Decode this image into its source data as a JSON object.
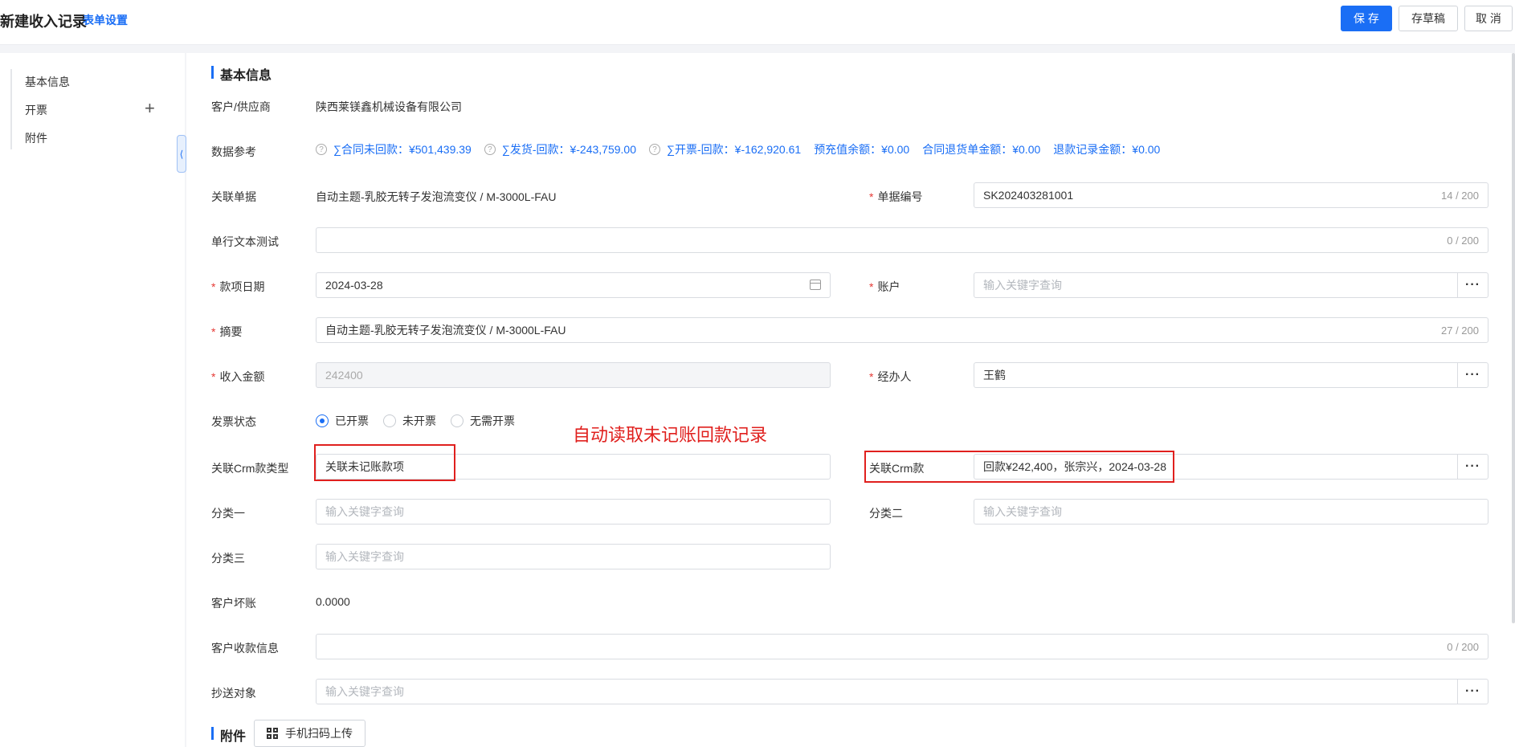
{
  "header": {
    "title": "新建收入记录",
    "form_settings": "表单设置",
    "save": "保 存",
    "draft": "存草稿",
    "cancel": "取 消"
  },
  "sidebar": {
    "items": [
      {
        "label": "基本信息"
      },
      {
        "label": "开票"
      },
      {
        "label": "附件"
      }
    ],
    "add_icon": "plus-icon",
    "collapse_glyph": "⟨"
  },
  "section_basic": "基本信息",
  "section_attachment": "附件",
  "fields": {
    "customer": {
      "label": "客户/供应商",
      "value": "陕西莱镁鑫机械设备有限公司"
    },
    "data_ref": {
      "label": "数据参考",
      "items": [
        "∑合同未回款：¥501,439.39",
        "∑发货-回款：¥-243,759.00",
        "∑开票-回款：¥-162,920.61",
        "预充值余额：¥0.00",
        "合同退货单金额：¥0.00",
        "退款记录金额：¥0.00"
      ]
    },
    "related_doc": {
      "label": "关联单据",
      "value": "自动主题-乳胶无转子发泡流变仪 / M-3000L-FAU"
    },
    "doc_no": {
      "label": "单据编号",
      "value": "SK202403281001",
      "counter": "14 / 200"
    },
    "single_text": {
      "label": "单行文本测试",
      "value": "",
      "counter": "0 / 200"
    },
    "date": {
      "label": "款项日期",
      "value": "2024-03-28"
    },
    "account": {
      "label": "账户",
      "placeholder": "输入关键字查询"
    },
    "summary": {
      "label": "摘要",
      "value": "自动主题-乳胶无转子发泡流变仪 / M-3000L-FAU",
      "counter": "27 / 200"
    },
    "amount": {
      "label": "收入金额",
      "value": "242400"
    },
    "handler": {
      "label": "经办人",
      "value": "王鹤"
    },
    "invoice_status": {
      "label": "发票状态",
      "options": [
        "已开票",
        "未开票",
        "无需开票"
      ],
      "selected": "已开票"
    },
    "crm_type": {
      "label": "关联Crm款类型",
      "value": "关联未记账款项"
    },
    "crm_payment": {
      "label": "关联Crm款",
      "value": "回款¥242,400，张宗兴，2024-03-28"
    },
    "cat1": {
      "label": "分类一",
      "placeholder": "输入关键字查询"
    },
    "cat2": {
      "label": "分类二",
      "placeholder": "输入关键字查询"
    },
    "cat3": {
      "label": "分类三",
      "placeholder": "输入关键字查询"
    },
    "bad_debt": {
      "label": "客户坏账",
      "value": "0.0000"
    },
    "receipt_info": {
      "label": "客户收款信息",
      "value": "",
      "counter": "0 / 200"
    },
    "cc": {
      "label": "抄送对象",
      "placeholder": "输入关键字查询"
    }
  },
  "annotation": "自动读取未记账回款记录",
  "upload": "手机扫码上传",
  "ellipsis": "···",
  "help_glyph": "?",
  "accent_color": "#1a6ef5",
  "annotation_color": "#e0201e"
}
